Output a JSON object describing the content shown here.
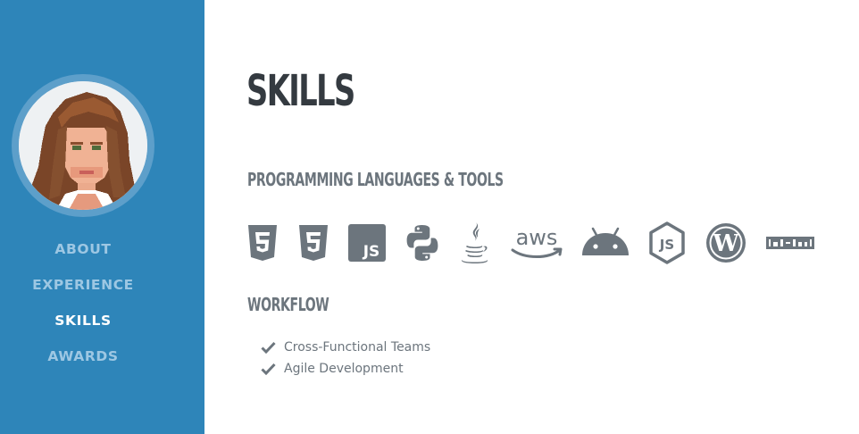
{
  "sidebar": {
    "avatar_alt": "profile avatar",
    "nav": [
      {
        "label": "ABOUT",
        "active": false
      },
      {
        "label": "EXPERIENCE",
        "active": false
      },
      {
        "label": "SKILLS",
        "active": true
      },
      {
        "label": "AWARDS",
        "active": false
      }
    ]
  },
  "main": {
    "title": "SKILLS",
    "languages_heading": "PROGRAMMING LANGUAGES & TOOLS",
    "tool_icons": [
      "html5-icon",
      "css3-icon",
      "js-square-icon",
      "python-icon",
      "java-icon",
      "aws-icon",
      "android-icon",
      "node-js-icon",
      "wordpress-icon",
      "npm-icon"
    ],
    "workflow_heading": "WORKFLOW",
    "workflow_items": [
      "Cross-Functional Teams",
      "Agile Development"
    ]
  },
  "colors": {
    "sidebar_bg": "#2e85b9",
    "nav_text": "#9dc7e3",
    "nav_active": "#ffffff",
    "title": "#343a40",
    "subhead": "#6c757d",
    "icon": "#6c757d"
  }
}
